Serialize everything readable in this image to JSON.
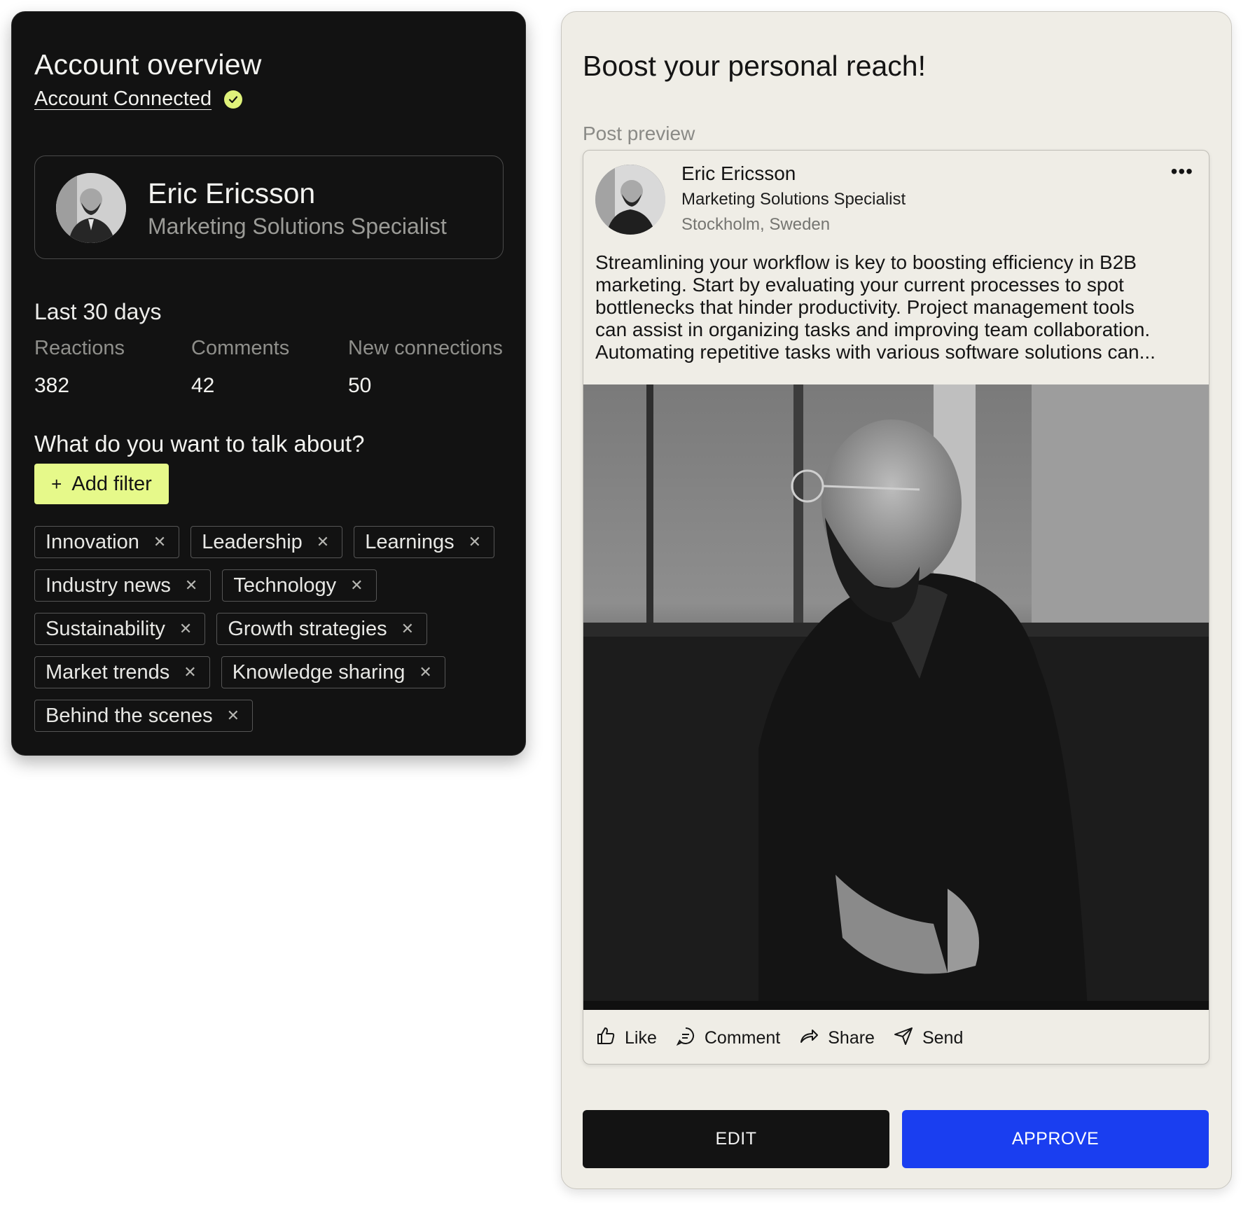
{
  "overview": {
    "title": "Account overview",
    "connected_label": "Account Connected",
    "profile": {
      "name": "Eric Ericsson",
      "title": "Marketing Solutions Specialist"
    },
    "period_label": "Last 30 days",
    "stats": [
      {
        "label": "Reactions",
        "value": "382"
      },
      {
        "label": "Comments",
        "value": "42"
      },
      {
        "label": "New connections",
        "value": "50"
      }
    ],
    "topics_heading": "What do you want to talk about?",
    "add_filter_label": "Add filter",
    "tags": [
      "Innovation",
      "Leadership",
      "Learnings",
      "Industry news",
      "Technology",
      "Sustainability",
      "Growth strategies",
      "Market trends",
      "Knowledge sharing",
      "Behind the scenes"
    ]
  },
  "preview": {
    "title": "Boost your personal reach!",
    "subtitle": "Post preview",
    "post": {
      "author": "Eric Ericsson",
      "role": "Marketing Solutions Specialist",
      "location": "Stockholm, Sweden",
      "more_icon": "more-dots-icon",
      "text_lines": [
        "Streamlining your workflow is key to boosting efficiency in B2B",
        "marketing. Start by evaluating your current processes to spot",
        "bottlenecks that hinder productivity. Project management tools",
        "can assist in organizing tasks and improving team collaboration.",
        "Automating repetitive tasks with various software solutions can..."
      ],
      "actions": [
        {
          "label": "Like",
          "icon": "thumbs-up-icon"
        },
        {
          "label": "Comment",
          "icon": "comment-icon"
        },
        {
          "label": "Share",
          "icon": "share-arrow-icon"
        },
        {
          "label": "Send",
          "icon": "send-plane-icon"
        }
      ]
    },
    "buttons": {
      "edit": "EDIT",
      "approve": "APPROVE"
    }
  },
  "colors": {
    "dark_card": "#121212",
    "accent_lime": "#e6f98a",
    "check_lime": "#dff27a",
    "approve_blue": "#1a3ef0",
    "light_card": "#efede6"
  }
}
